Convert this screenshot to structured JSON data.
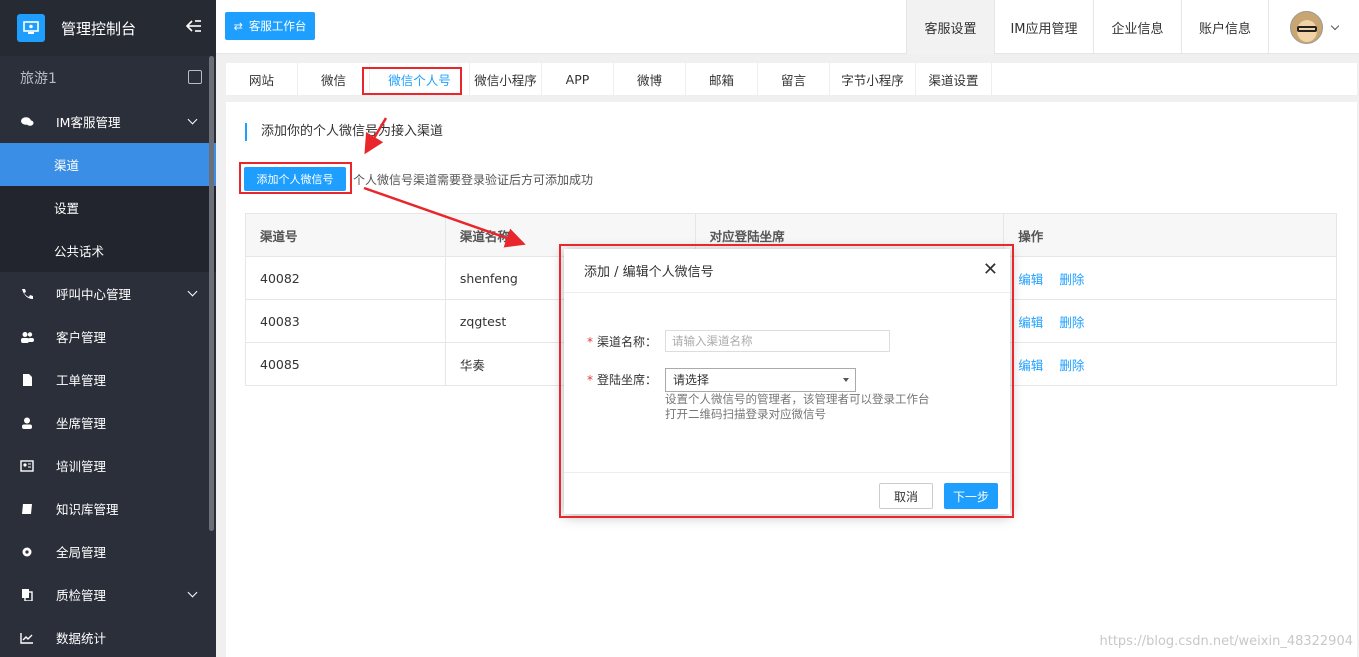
{
  "app": {
    "title": "管理控制台",
    "workspace_button": "客服工作台",
    "collapse_icon": "collapse-left-icon",
    "sub_title": "旅游1"
  },
  "sidebar": {
    "items": [
      {
        "label": "IM客服管理",
        "icon": "chat-icon",
        "expandable": true
      },
      {
        "label": "渠道",
        "sub": true,
        "active": true
      },
      {
        "label": "设置",
        "sub": true
      },
      {
        "label": "公共话术",
        "sub": true
      },
      {
        "label": "呼叫中心管理",
        "icon": "phone-icon",
        "expandable": true
      },
      {
        "label": "客户管理",
        "icon": "users-icon"
      },
      {
        "label": "工单管理",
        "icon": "file-icon"
      },
      {
        "label": "坐席管理",
        "icon": "user-icon"
      },
      {
        "label": "培训管理",
        "icon": "id-card-icon"
      },
      {
        "label": "知识库管理",
        "icon": "book-icon"
      },
      {
        "label": "全局管理",
        "icon": "gear-icon"
      },
      {
        "label": "质检管理",
        "icon": "copy-icon",
        "expandable": true
      },
      {
        "label": "数据统计",
        "icon": "chart-icon"
      }
    ]
  },
  "top_nav": {
    "items": [
      "客服设置",
      "IM应用管理",
      "企业信息",
      "账户信息"
    ],
    "active": "客服设置"
  },
  "tabs": {
    "items": [
      "网站",
      "微信",
      "微信个人号",
      "微信小程序",
      "APP",
      "微博",
      "邮箱",
      "留言",
      "字节小程序",
      "渠道设置"
    ],
    "active": "微信个人号"
  },
  "main": {
    "section_title": "添加你的个人微信号为接入渠道",
    "add_button": "添加个人微信号",
    "hint": "个人微信号渠道需要登录验证后方可添加成功",
    "table": {
      "headers": [
        "渠道号",
        "渠道名称",
        "对应登陆坐席",
        "操作"
      ],
      "rows": [
        {
          "id": "40082",
          "name": "shenfeng",
          "seat": "",
          "edit": "编辑",
          "delete": "删除"
        },
        {
          "id": "40083",
          "name": "zqgtest",
          "seat": "",
          "edit": "编辑",
          "delete": "删除"
        },
        {
          "id": "40085",
          "name": "华奏",
          "seat": "",
          "edit": "编辑",
          "delete": "删除"
        }
      ]
    }
  },
  "modal": {
    "title": "添加 / 编辑个人微信号",
    "field1_label": "渠道名称：",
    "field1_placeholder": "请输入渠道名称",
    "field2_label": "登陆坐席：",
    "field2_value": "请选择",
    "help_line1": "设置个人微信号的管理者，该管理者可以登录工作台",
    "help_line2": "打开二维码扫描登录对应微信号",
    "cancel": "取消",
    "next": "下一步",
    "required_mark": "*"
  },
  "watermark": "https://blog.csdn.net/weixin_48322904",
  "colors": {
    "accent": "#1e9fff",
    "sidebar_bg": "#2b2f3a",
    "sidebar_active": "#3a8ee6",
    "highlight_red": "#e8262b"
  }
}
